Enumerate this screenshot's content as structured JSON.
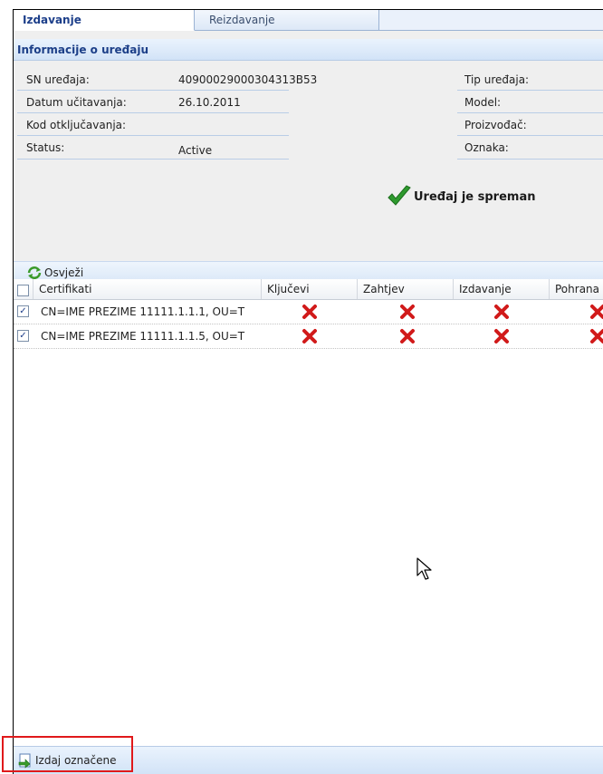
{
  "tabs": [
    {
      "label": "Izdavanje",
      "active": true
    },
    {
      "label": "Reizdavanje",
      "active": false
    }
  ],
  "info_section": {
    "title": "Informacije o uređaju",
    "fields_left": [
      {
        "label": "SN uređaja:",
        "value": "40900029000304313B53"
      },
      {
        "label": "Datum učitavanja:",
        "value": "26.10.2011"
      },
      {
        "label": "Kod otključavanja:",
        "value": ""
      },
      {
        "label": "Status:",
        "value": "Active"
      }
    ],
    "fields_right": [
      {
        "label": "Tip uređaja:",
        "value": ""
      },
      {
        "label": "Model:",
        "value": ""
      },
      {
        "label": "Proizvođač:",
        "value": ""
      },
      {
        "label": "Oznaka:",
        "value": ""
      }
    ],
    "ready_message": "Uređaj je spreman"
  },
  "toolbar": {
    "refresh_label": "Osvježi"
  },
  "grid": {
    "columns": [
      "Certifikati",
      "Ključevi",
      "Zahtjev",
      "Izdavanje",
      "Pohrana"
    ],
    "rows": [
      {
        "checked": true,
        "certificate": "CN=IME PREZIME 11111.1.1.1, OU=T",
        "statuses": [
          "x",
          "x",
          "x",
          "x"
        ]
      },
      {
        "checked": true,
        "certificate": "CN=IME PREZIME 11111.1.1.5, OU=T",
        "statuses": [
          "x",
          "x",
          "x",
          "x"
        ]
      }
    ]
  },
  "bottom_bar": {
    "issue_selected_label": "Izdaj označene"
  },
  "colors": {
    "accent": "#1c3f88",
    "status_fail": "#d11a1a",
    "status_ok": "#2e9a2e",
    "highlight": "#e0191b"
  }
}
